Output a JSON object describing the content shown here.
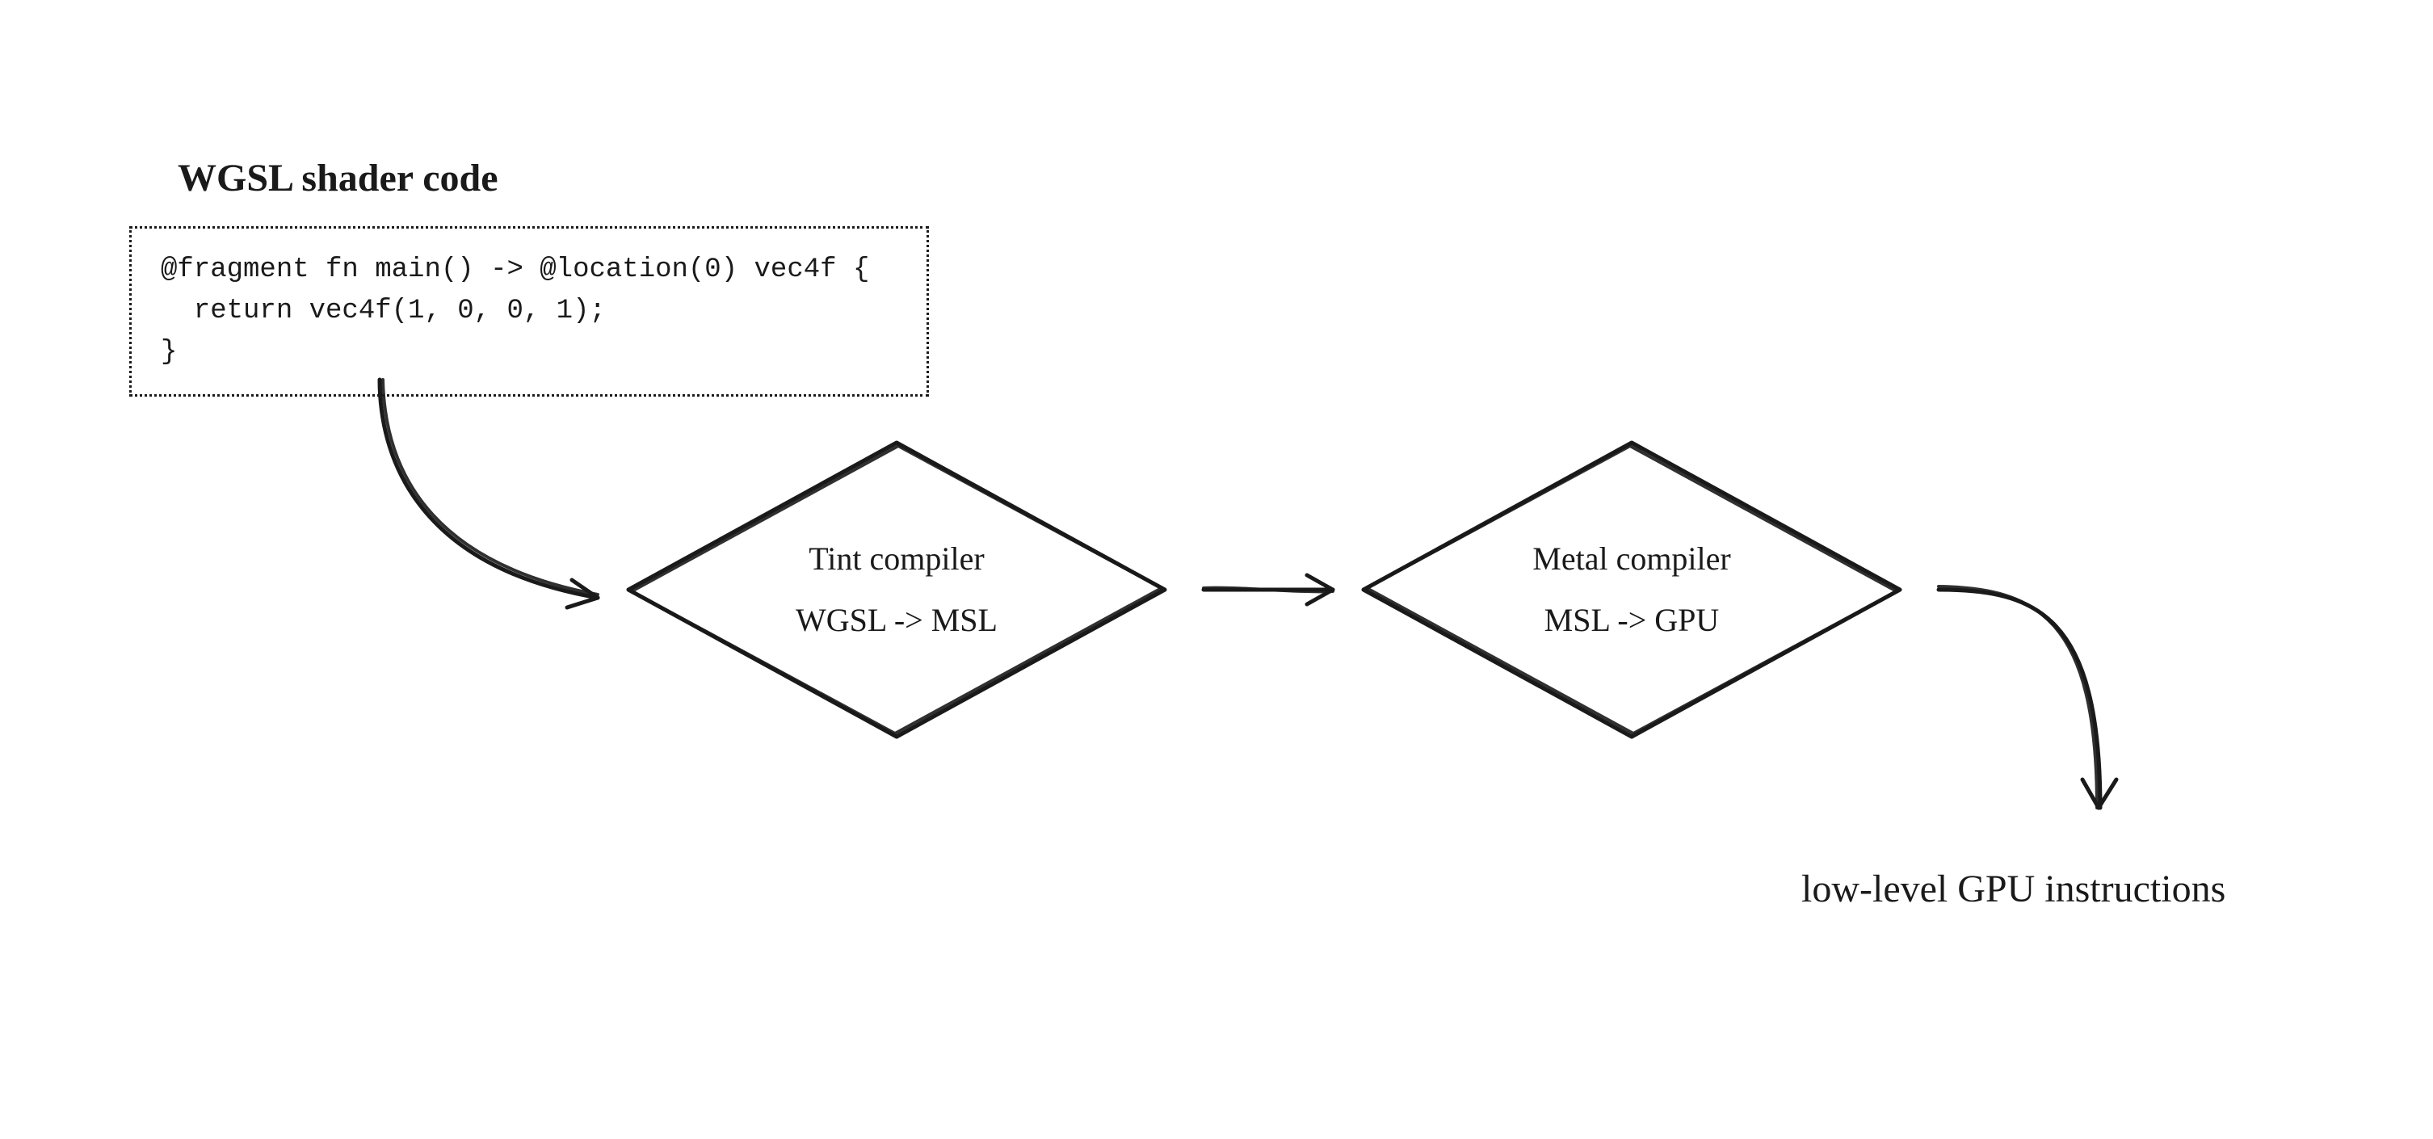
{
  "wgsl": {
    "title": "WGSL shader code",
    "line1": "@fragment fn main() -> @location(0) vec4f {",
    "line2": "  return vec4f(1, 0, 0, 1);",
    "line3": "}"
  },
  "tint": {
    "title": "Tint compiler",
    "sub": "WGSL -> MSL"
  },
  "metal": {
    "title": "Metal compiler",
    "sub": "MSL -> GPU"
  },
  "output": {
    "label": "low-level GPU instructions"
  }
}
